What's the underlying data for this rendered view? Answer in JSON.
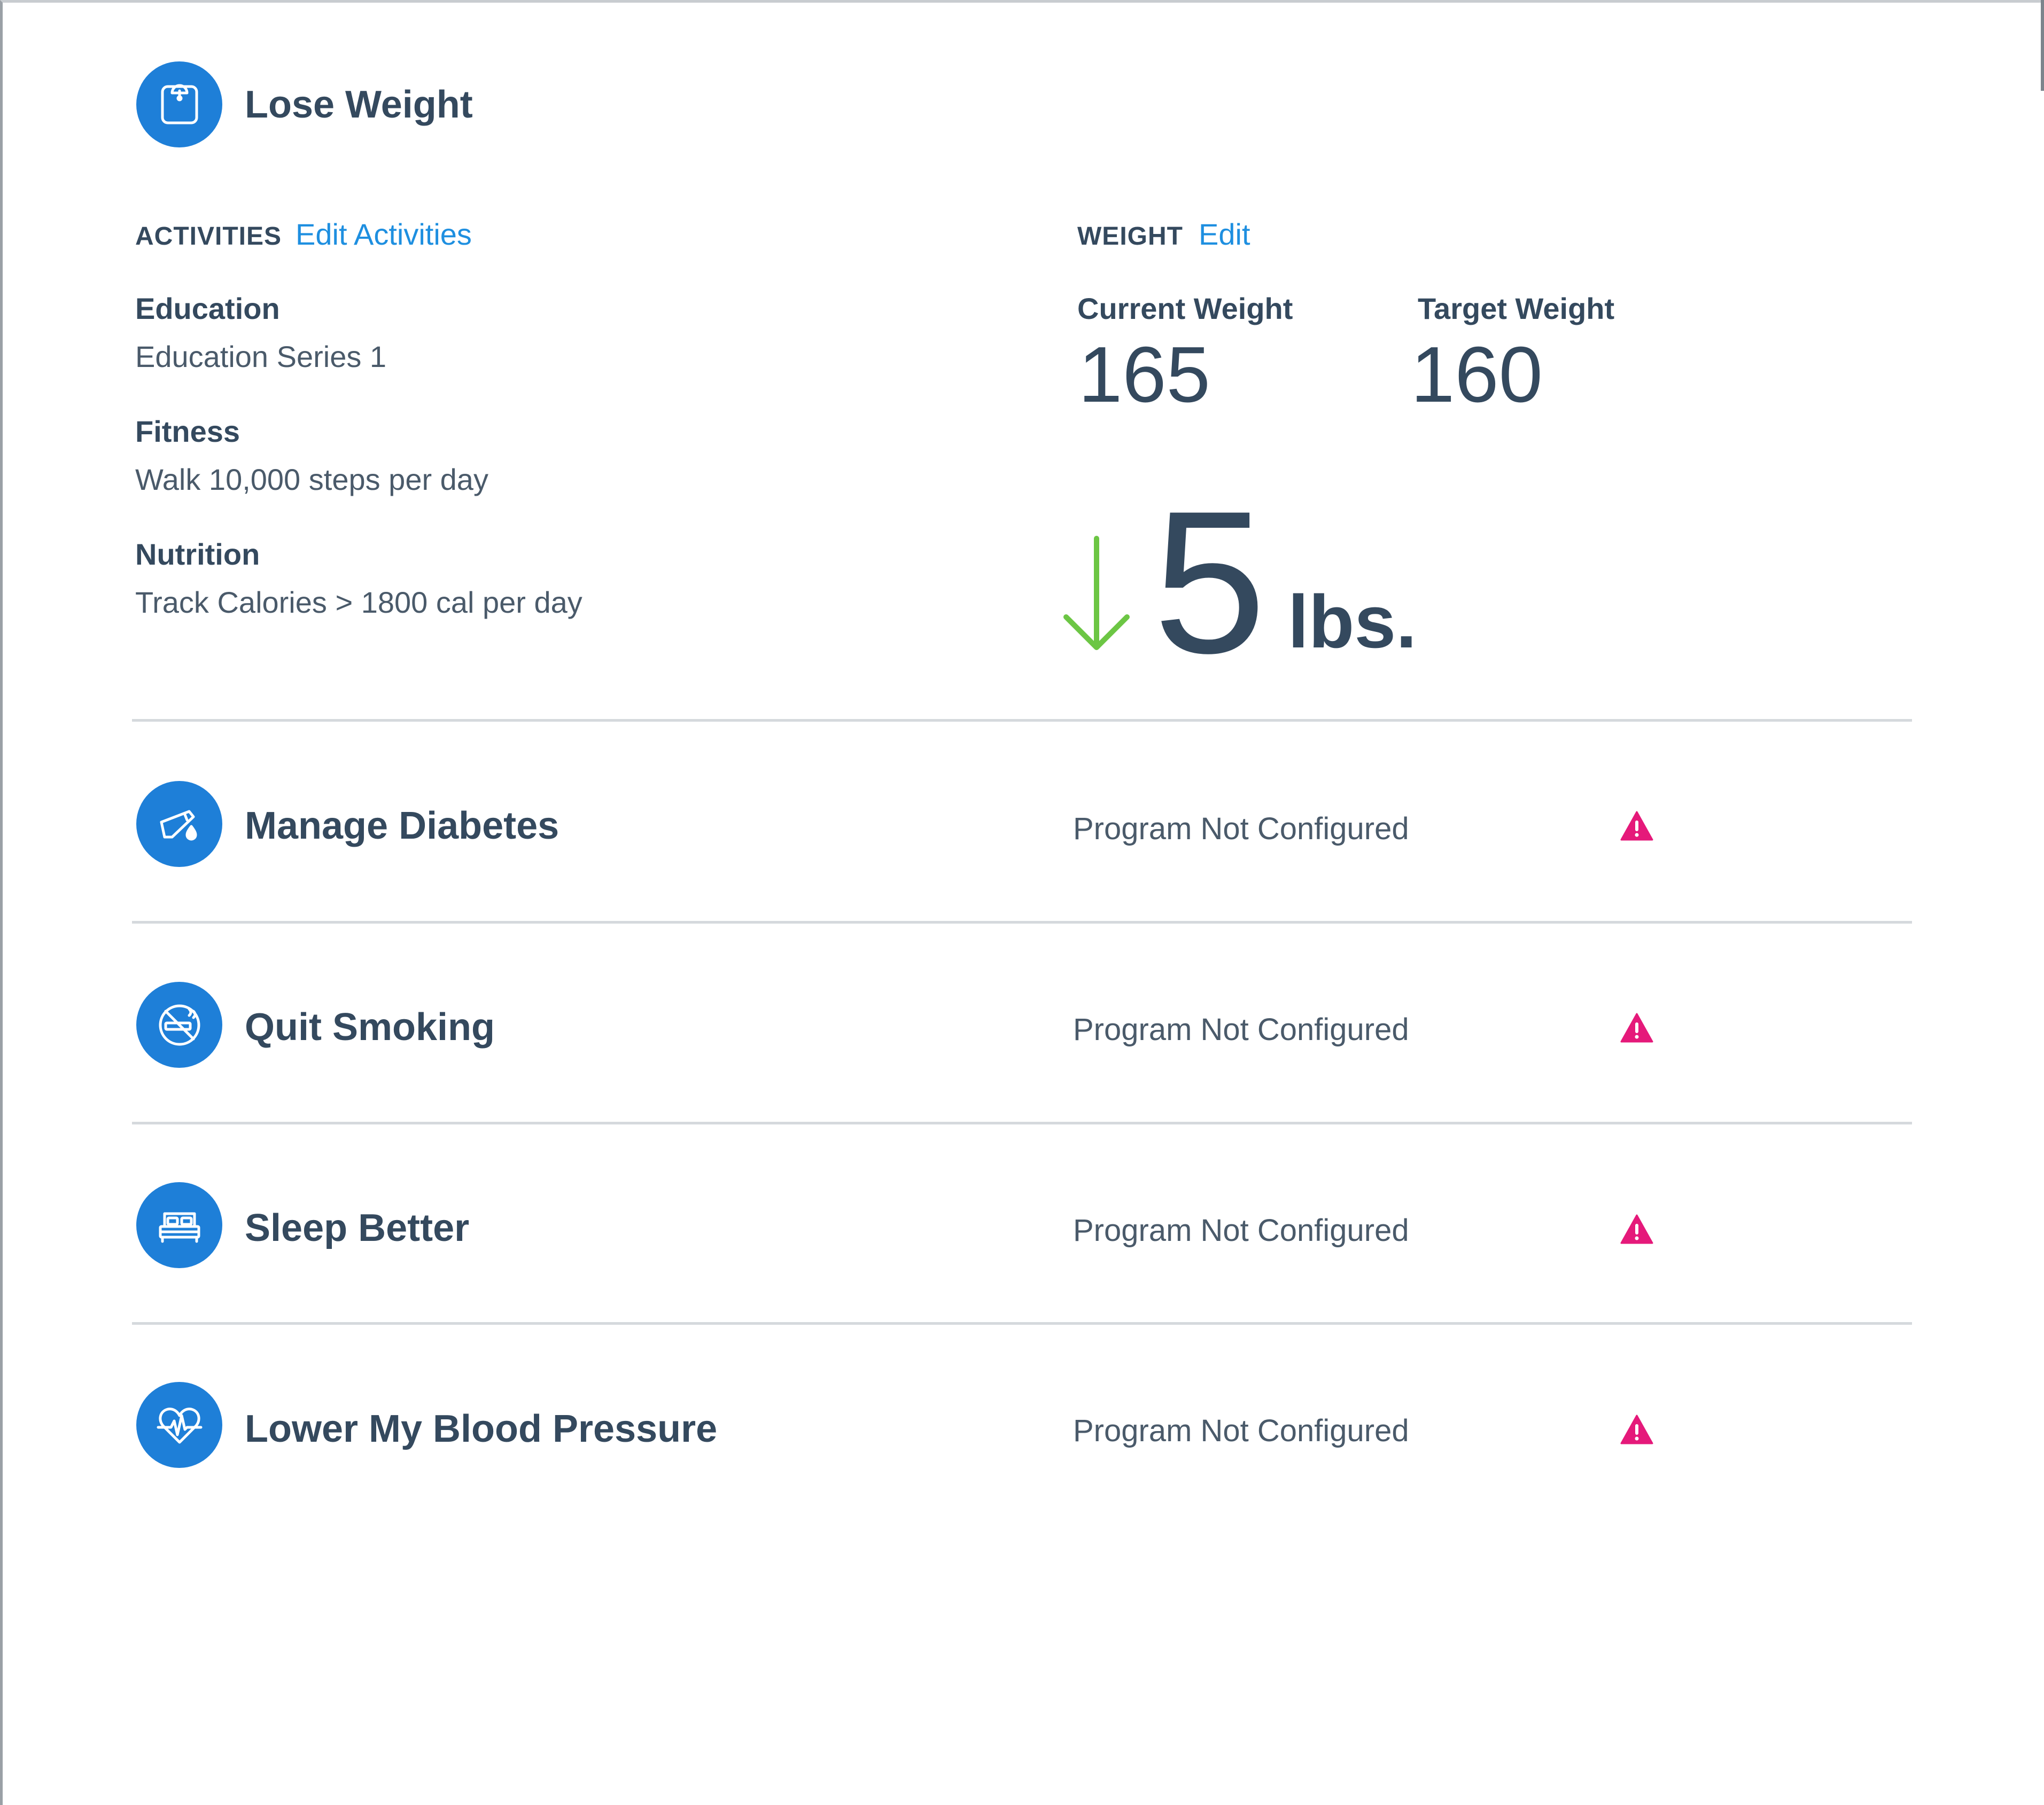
{
  "lose_weight": {
    "title": "Lose Weight",
    "activities_label": "ACTIVITIES",
    "edit_activities": "Edit Activities",
    "activities": [
      {
        "category": "Education",
        "value": "Education Series 1"
      },
      {
        "category": "Fitness",
        "value": "Walk 10,000 steps per day"
      },
      {
        "category": "Nutrition",
        "value": "Track Calories > 1800 cal per day"
      }
    ],
    "weight_label": "WEIGHT",
    "edit_weight": "Edit",
    "current_weight_label": "Current Weight",
    "current_weight": "165",
    "target_weight_label": "Target Weight",
    "target_weight": "160",
    "difference_value": "5",
    "difference_unit": "lbs.",
    "difference_direction": "down"
  },
  "programs": [
    {
      "title": "Manage Diabetes",
      "status": "Program Not Configured",
      "icon": "glucose-meter-icon"
    },
    {
      "title": "Quit Smoking",
      "status": "Program Not Configured",
      "icon": "no-smoking-icon"
    },
    {
      "title": "Sleep Better",
      "status": "Program Not Configured",
      "icon": "bed-icon"
    },
    {
      "title": "Lower My Blood Pressure",
      "status": "Program Not Configured",
      "icon": "heart-rate-icon"
    }
  ],
  "colors": {
    "accent": "#1e7fd8",
    "link": "#1e8fe0",
    "text": "#34495e",
    "success_arrow": "#6cc644",
    "warning": "#e5197a",
    "divider": "#d5d9dd"
  }
}
